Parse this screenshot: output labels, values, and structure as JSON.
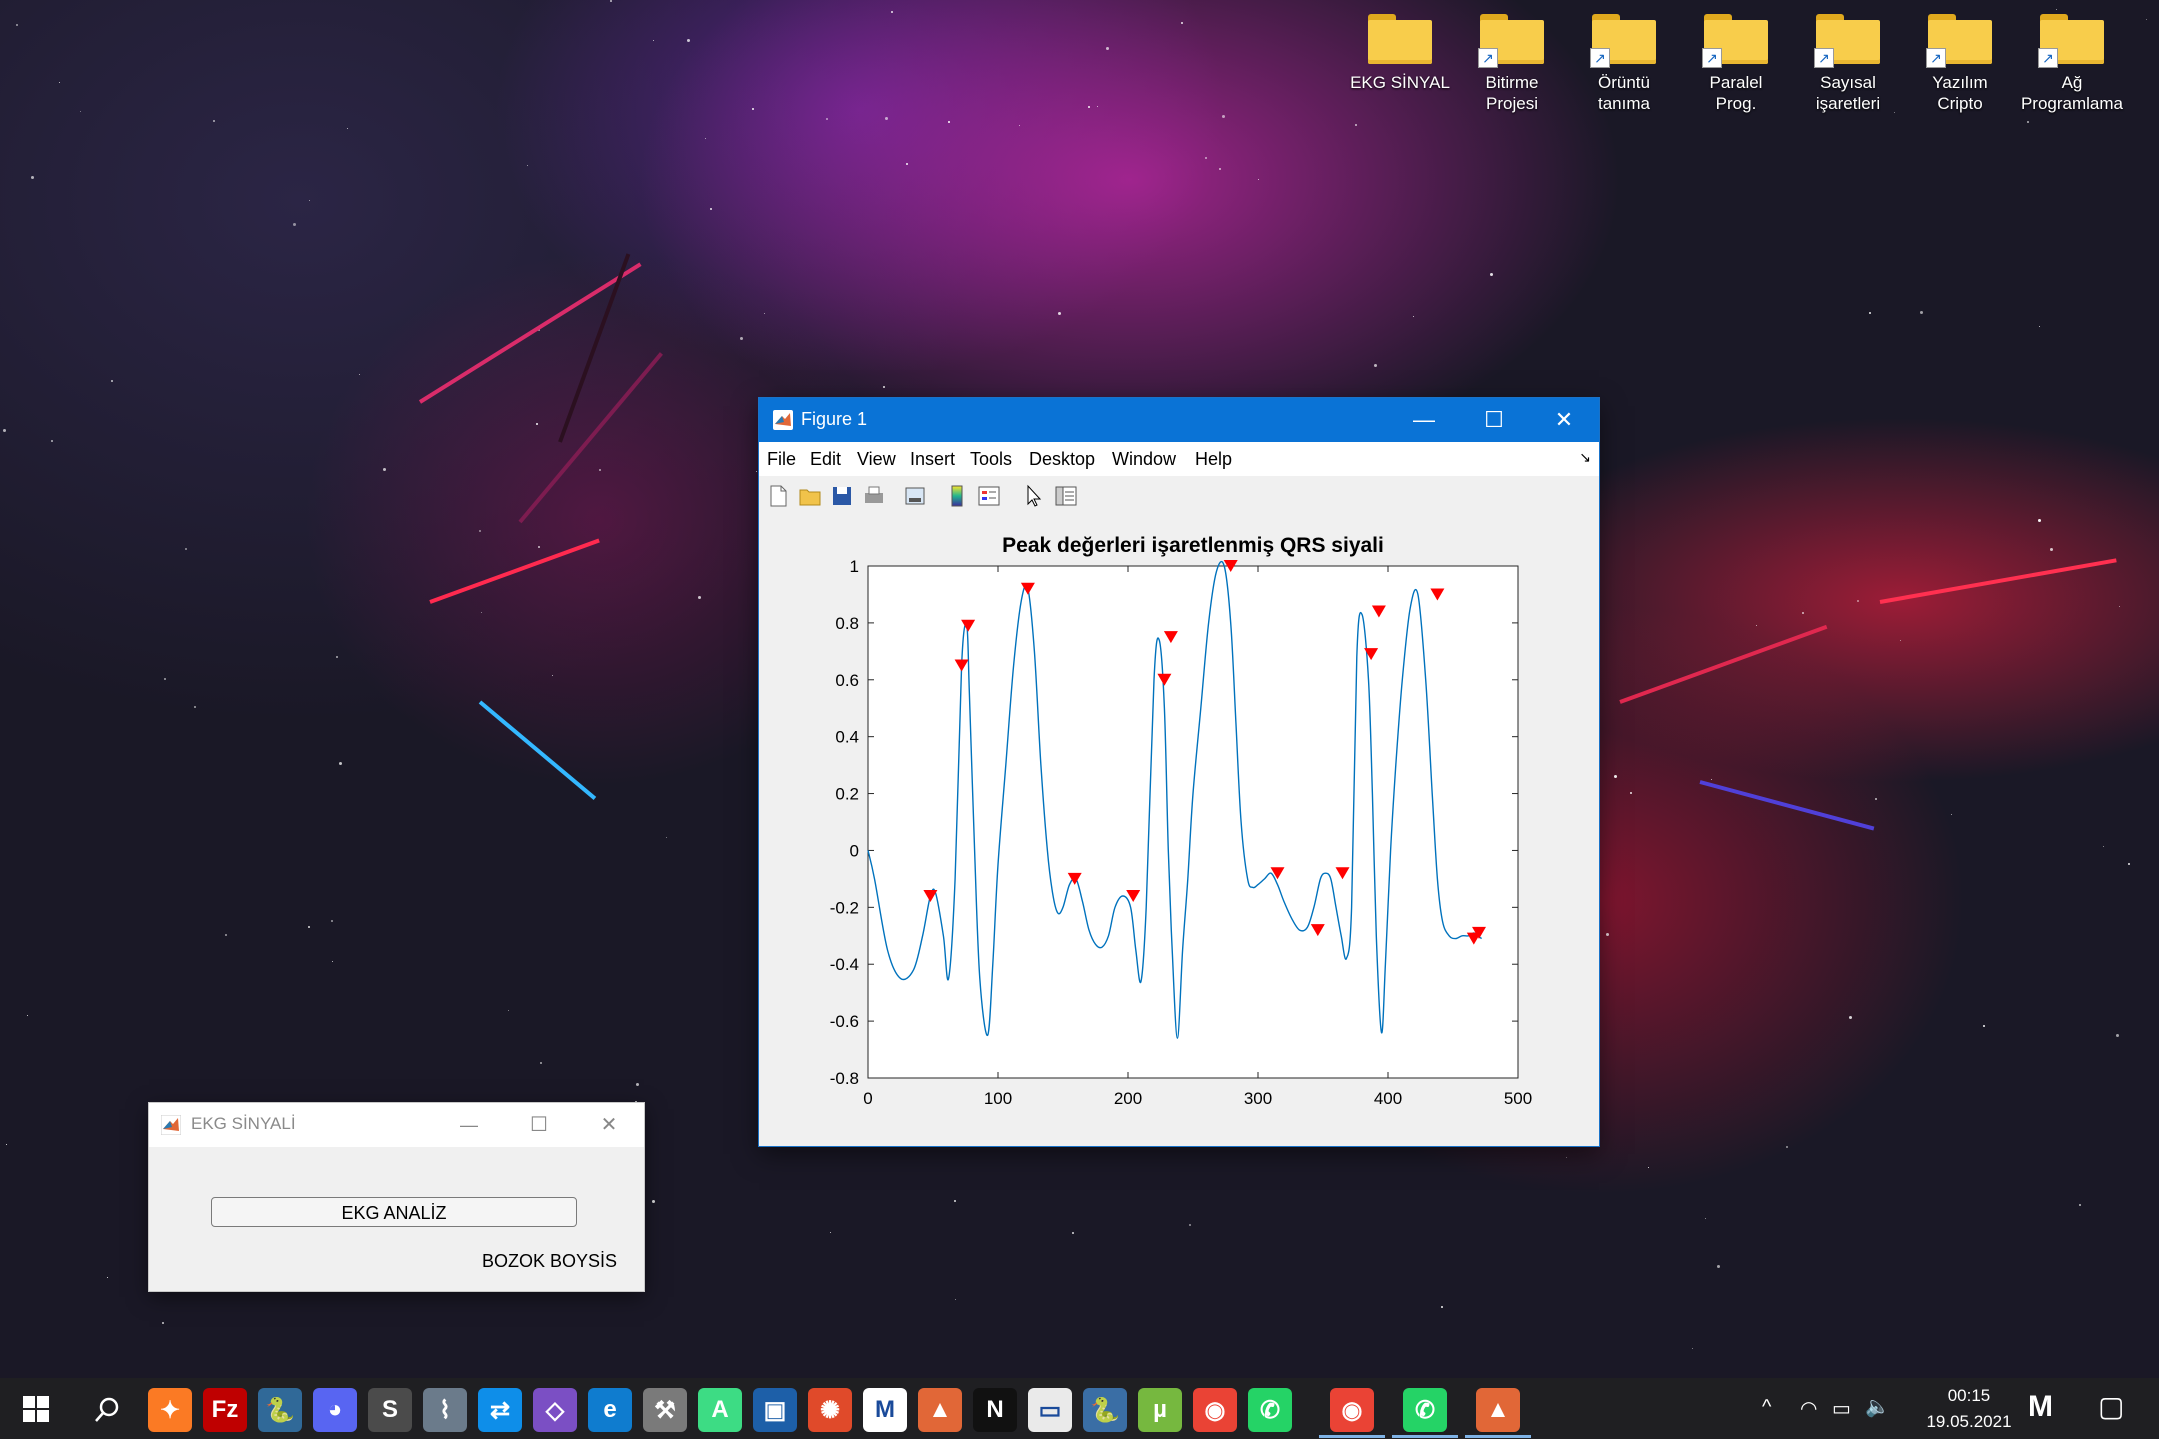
{
  "desktop": {
    "icons": [
      {
        "label_1": "EKG SİNYAL",
        "label_2": "",
        "shortcut": false
      },
      {
        "label_1": "Bitirme",
        "label_2": "Projesi",
        "shortcut": true
      },
      {
        "label_1": "Örüntü",
        "label_2": "tanıma",
        "shortcut": true
      },
      {
        "label_1": "Paralel",
        "label_2": "Prog.",
        "shortcut": true
      },
      {
        "label_1": "Sayısal",
        "label_2": "işaretleri",
        "shortcut": true
      },
      {
        "label_1": "Yazılım",
        "label_2": "Cripto",
        "shortcut": true
      },
      {
        "label_1": "Ağ",
        "label_2": "Programlama",
        "shortcut": true
      }
    ],
    "shortcut_arrow": "↗"
  },
  "figure": {
    "title": "Figure 1",
    "controls": {
      "minimize": "—",
      "maximize": "☐",
      "close": "✕"
    },
    "menu": [
      "File",
      "Edit",
      "View",
      "Insert",
      "Tools",
      "Desktop",
      "Window",
      "Help"
    ],
    "toolbar_icons": [
      "new-figure-icon",
      "open-file-icon",
      "save-icon",
      "print-icon",
      "print-preview-icon",
      "colorbar-icon",
      "legend-icon",
      "edit-plot-pointer-icon",
      "property-editor-icon"
    ],
    "dock_arrow": "↘"
  },
  "chart_data": {
    "type": "line",
    "title": "Peak değerleri işaretlenmiş QRS siyali",
    "xlabel": "",
    "ylabel": "",
    "xlim": [
      0,
      500
    ],
    "ylim": [
      -0.8,
      1
    ],
    "xticks": [
      0,
      100,
      200,
      300,
      400,
      500
    ],
    "yticks": [
      1,
      0.8,
      0.6,
      0.4,
      0.2,
      0,
      -0.2,
      -0.4,
      -0.6,
      -0.8
    ],
    "ytick_labels": [
      "1",
      "0.8",
      "0.6",
      "0.4",
      "0.2",
      "0",
      "-0.2",
      "-0.4",
      "-0.6",
      "-0.8"
    ],
    "xtick_labels": [
      "0",
      "100",
      "200",
      "300",
      "400",
      "500"
    ],
    "line_color": "#0072bd",
    "marker_color": "#ff0000",
    "grid": false,
    "series": [
      {
        "x": [
          0,
          5,
          15,
          25,
          35,
          42,
          48,
          52,
          58,
          62,
          67,
          72,
          76,
          78,
          82,
          86,
          92,
          96,
          100,
          106,
          112,
          118,
          123,
          128,
          133,
          138,
          142,
          146,
          150,
          155,
          160,
          165,
          170,
          175,
          180,
          185,
          190,
          196,
          202,
          206,
          210,
          214,
          220,
          224,
          228,
          231,
          234,
          238,
          242,
          246,
          250,
          256,
          262,
          268,
          274,
          279,
          283,
          287,
          292,
          296,
          300,
          305,
          310,
          315,
          320,
          326,
          332,
          338,
          343,
          348,
          352,
          356,
          360,
          364,
          368,
          372,
          376,
          380,
          385,
          388,
          391,
          395,
          398,
          402,
          406,
          411,
          417,
          423,
          429,
          434,
          438,
          442,
          447,
          452,
          457,
          462,
          466,
          469,
          472
        ],
        "y": [
          0,
          -0.1,
          -0.35,
          -0.45,
          -0.42,
          -0.3,
          -0.16,
          -0.15,
          -0.3,
          -0.45,
          -0.1,
          0.65,
          0.79,
          0.55,
          0.0,
          -0.45,
          -0.65,
          -0.4,
          -0.05,
          0.3,
          0.65,
          0.88,
          0.92,
          0.7,
          0.3,
          0.0,
          -0.15,
          -0.22,
          -0.2,
          -0.12,
          -0.1,
          -0.18,
          -0.28,
          -0.33,
          -0.34,
          -0.3,
          -0.2,
          -0.16,
          -0.2,
          -0.35,
          -0.46,
          -0.2,
          0.6,
          0.74,
          0.5,
          0.0,
          -0.35,
          -0.66,
          -0.35,
          -0.1,
          0.2,
          0.5,
          0.8,
          0.98,
          1.0,
          0.8,
          0.45,
          0.1,
          -0.1,
          -0.13,
          -0.12,
          -0.1,
          -0.08,
          -0.12,
          -0.18,
          -0.24,
          -0.28,
          -0.27,
          -0.2,
          -0.1,
          -0.08,
          -0.1,
          -0.2,
          -0.3,
          -0.38,
          -0.2,
          0.68,
          0.83,
          0.6,
          0.2,
          -0.3,
          -0.64,
          -0.4,
          0.0,
          0.3,
          0.6,
          0.85,
          0.9,
          0.6,
          0.2,
          -0.1,
          -0.25,
          -0.3,
          -0.31,
          -0.3,
          -0.3,
          -0.29,
          -0.3,
          -0.31
        ]
      }
    ],
    "peaks": {
      "x": [
        48,
        72,
        77,
        123,
        159,
        204,
        228,
        233,
        279,
        315,
        346,
        365,
        387,
        393,
        438,
        466,
        470
      ],
      "y": [
        -0.16,
        0.65,
        0.79,
        0.92,
        -0.1,
        -0.16,
        0.6,
        0.75,
        1.0,
        -0.08,
        -0.28,
        -0.08,
        0.69,
        0.84,
        0.9,
        -0.31,
        -0.29
      ]
    }
  },
  "ekg_app": {
    "title": "EKG SİNYALİ",
    "controls": {
      "minimize": "—",
      "maximize": "☐",
      "close": "✕"
    },
    "analyze_button": "EKG ANALİZ",
    "author": "BOZOK BOYSİS"
  },
  "taskbar": {
    "apps": [
      {
        "name": "xampp",
        "glyph": "✦",
        "color": "#fb7a24"
      },
      {
        "name": "filezilla",
        "glyph": "Fz",
        "color": "#bf0000"
      },
      {
        "name": "python-idle",
        "glyph": "🐍",
        "color": "#306998"
      },
      {
        "name": "discord",
        "glyph": "◕",
        "color": "#5865f2"
      },
      {
        "name": "sublime-text",
        "glyph": "S",
        "color": "#4b4b4b"
      },
      {
        "name": "system-monitor",
        "glyph": "⌇",
        "color": "#6b7b8b"
      },
      {
        "name": "teamviewer",
        "glyph": "⇄",
        "color": "#0e8ee9"
      },
      {
        "name": "visual-studio",
        "glyph": "◇",
        "color": "#7b4fc4"
      },
      {
        "name": "edge",
        "glyph": "e",
        "color": "#0f7ccf"
      },
      {
        "name": "dev-tools",
        "glyph": "⚒",
        "color": "#7a7a7a"
      },
      {
        "name": "android-studio",
        "glyph": "A",
        "color": "#3ddc84"
      },
      {
        "name": "virtualbox",
        "glyph": "▣",
        "color": "#1d5fa8"
      },
      {
        "name": "aperture",
        "glyph": "✺",
        "color": "#e04a2a"
      },
      {
        "name": "gmail-app",
        "glyph": "M",
        "color": "#ffffff"
      },
      {
        "name": "matlab",
        "glyph": "▲",
        "color": "#e16737"
      },
      {
        "name": "netflix",
        "glyph": "N",
        "color": "#111111"
      },
      {
        "name": "notepad",
        "glyph": "▭",
        "color": "#eaeaea"
      },
      {
        "name": "python",
        "glyph": "🐍",
        "color": "#3a6ea5"
      },
      {
        "name": "utorrent",
        "glyph": "µ",
        "color": "#76b83f"
      },
      {
        "name": "chrome",
        "glyph": "◉",
        "color": "#ea4335"
      },
      {
        "name": "whatsapp",
        "glyph": "✆",
        "color": "#25d366"
      },
      {
        "name": "chrome-running",
        "glyph": "◉",
        "color": "#ea4335"
      },
      {
        "name": "whatsapp-running",
        "glyph": "✆",
        "color": "#25d366"
      },
      {
        "name": "matlab-running",
        "glyph": "▲",
        "color": "#e16737"
      }
    ],
    "time": "00:15",
    "date": "19.05.2021",
    "tray_glyphs": {
      "chevron": "^",
      "network": "◠",
      "battery": "▭",
      "volume": "🔈",
      "notification": "▢",
      "brand": "M"
    }
  }
}
